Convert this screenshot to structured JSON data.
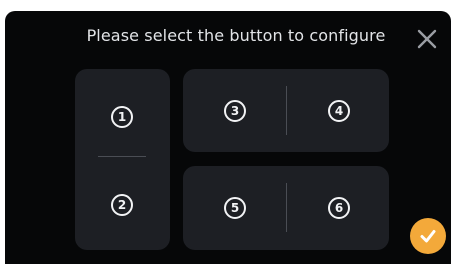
{
  "dialog": {
    "title": "Please select the button to configure",
    "close_icon": "close-icon",
    "confirm_icon": "check-icon"
  },
  "buttons": [
    {
      "label": "1",
      "glyph": "①"
    },
    {
      "label": "2",
      "glyph": "②"
    },
    {
      "label": "3",
      "glyph": "③"
    },
    {
      "label": "4",
      "glyph": "④"
    },
    {
      "label": "5",
      "glyph": "⑤"
    },
    {
      "label": "6",
      "glyph": "⑥"
    }
  ],
  "colors": {
    "background": "#060708",
    "panel": "#1d1f24",
    "text": "#e2e4e7",
    "accent": "#f3a93a",
    "divider": "#4a4d54"
  }
}
